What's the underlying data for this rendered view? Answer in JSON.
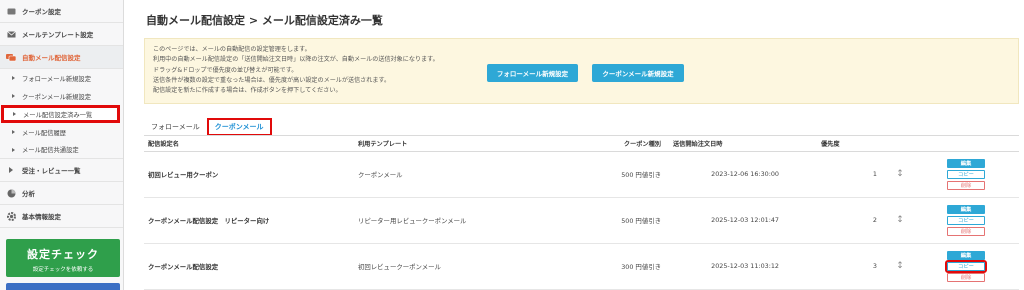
{
  "sidebar": {
    "items": [
      {
        "label": "クーポン設定",
        "icon": "coupon-icon"
      },
      {
        "label": "メールテンプレート設定",
        "icon": "mail-icon"
      },
      {
        "label": "自動メール配信設定",
        "icon": "auto-mail-icon"
      },
      {
        "label": "受注・レビュー一覧",
        "icon": "list-icon"
      },
      {
        "label": "分析",
        "icon": "pie-chart-icon"
      },
      {
        "label": "基本情報設定",
        "icon": "gear-icon"
      }
    ],
    "sub_items": [
      {
        "label": "フォローメール新規設定"
      },
      {
        "label": "クーポンメール新規設定"
      },
      {
        "label": "メール配信設定済み一覧"
      },
      {
        "label": "メール配信履歴"
      },
      {
        "label": "メール配信共通設定"
      }
    ],
    "check": {
      "title": "設定チェック",
      "subtitle": "設定チェックを依頼する"
    }
  },
  "page": {
    "title": "自動メール配信設定 > メール配信設定済み一覧"
  },
  "notice": {
    "lines": [
      "このページでは、メールの自動配信の設定管理をします。",
      "利用中の自動メール配信設定の「送信開始注文日時」以降の注文が、自動メールの送信対象になります。",
      "ドラッグ&ドロップで優先度の並び替えが可能です。",
      "送信条件が複数の設定で重なった場合は、優先度が高い設定のメールが送信されます。",
      "配信設定を新たに作成する場合は、作成ボタンを押下してください。"
    ],
    "follow_button": "フォローメール新規設定",
    "coupon_button": "クーポンメール新規設定"
  },
  "tabs": [
    {
      "label": "フォローメール"
    },
    {
      "label": "クーポンメール"
    }
  ],
  "table": {
    "headers": [
      "配信設定名",
      "利用テンプレート",
      "クーポン種別",
      "送信開始注文日時",
      "優先度",
      ""
    ],
    "rows": [
      {
        "name": "初回レビュー用クーポン",
        "template": "クーポンメール",
        "coupon": "500 円値引き",
        "date": "2023-12-06 16:30:00",
        "priority": "1"
      },
      {
        "name": "クーポンメール配信設定　リピーター向け",
        "template": "リピーター用レビュークーポンメール",
        "coupon": "500 円値引き",
        "date": "2025-12-03 12:01:47",
        "priority": "2"
      },
      {
        "name": "クーポンメール配信設定",
        "template": "初回レビュークーポンメール",
        "coupon": "300 円値引き",
        "date": "2025-12-03 11:03:12",
        "priority": "3"
      }
    ],
    "actions": {
      "edit": "編集",
      "copy": "コピー",
      "delete": "削除"
    }
  }
}
